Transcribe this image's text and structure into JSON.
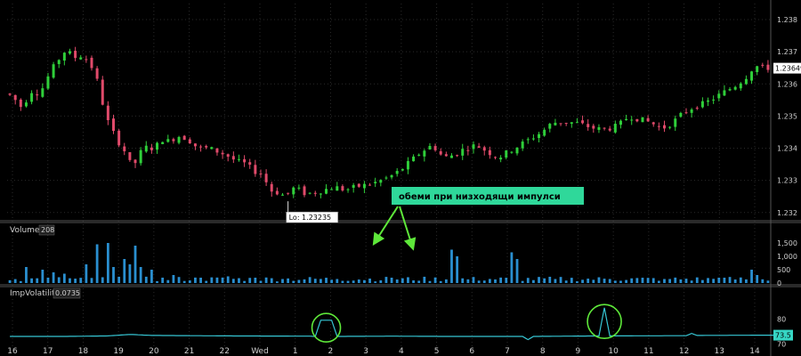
{
  "colors": {
    "background": "#000000",
    "grid": "#2a2a2a",
    "panel_border": "#555555",
    "candle_up": "#2fcf3a",
    "candle_down": "#e04a6a",
    "volume": "#2a8fd0",
    "volatility": "#36c6d4",
    "annotation_bg": "#2fd89a",
    "annotation_arrow": "#5ee83a",
    "price_tag_bg": "#ffffff",
    "vol_tag_bg": "#36d6c4",
    "axis_text": "#cfcfcf"
  },
  "chart_data": [
    {
      "type": "candlestick",
      "panel": "price",
      "x_ticks": [
        "16",
        "17",
        "18",
        "19",
        "20",
        "21",
        "22",
        "Wed",
        "1",
        "2",
        "3",
        "4",
        "5",
        "6",
        "7",
        "8",
        "9",
        "10",
        "11",
        "12",
        "13",
        "14"
      ],
      "y_ticks": [
        "1.238",
        "1.237",
        "1.236",
        "1.235",
        "1.234",
        "1.233",
        "1.232"
      ],
      "ylim": [
        1.2318,
        1.2385
      ],
      "current_price": "1.23649",
      "low_label": "Lo: 1.23235",
      "low_value": 1.23235,
      "annotation": "обеми при низходящи импулси",
      "path": [
        [
          0,
          1.2357
        ],
        [
          1,
          1.2356
        ],
        [
          2,
          1.2354
        ],
        [
          3,
          1.2352
        ],
        [
          4,
          1.2358
        ],
        [
          6,
          1.2357
        ],
        [
          8,
          1.2364
        ],
        [
          10,
          1.2369
        ],
        [
          11,
          1.2371
        ],
        [
          12,
          1.2368
        ],
        [
          14,
          1.2369
        ],
        [
          16,
          1.2364
        ],
        [
          17,
          1.2358
        ],
        [
          18,
          1.235
        ],
        [
          20,
          1.2343
        ],
        [
          22,
          1.2338
        ],
        [
          23,
          1.2333
        ],
        [
          24,
          1.2338
        ],
        [
          26,
          1.2341
        ],
        [
          27,
          1.2339
        ],
        [
          28,
          1.2343
        ],
        [
          30,
          1.2342
        ],
        [
          31,
          1.2344
        ],
        [
          33,
          1.2343
        ],
        [
          35,
          1.234
        ],
        [
          37,
          1.234
        ],
        [
          40,
          1.2338
        ],
        [
          42,
          1.2336
        ],
        [
          44,
          1.2335
        ],
        [
          45,
          1.2333
        ],
        [
          47,
          1.2332
        ],
        [
          48,
          1.2327
        ],
        [
          50,
          1.2326
        ],
        [
          51,
          1.2325
        ],
        [
          52,
          1.2327
        ],
        [
          53,
          1.2328
        ],
        [
          54,
          1.2326
        ],
        [
          56,
          1.2326
        ],
        [
          58,
          1.2327
        ],
        [
          60,
          1.2328
        ],
        [
          62,
          1.2327
        ],
        [
          64,
          1.2328
        ],
        [
          67,
          1.2329
        ],
        [
          70,
          1.2331
        ],
        [
          72,
          1.2333
        ],
        [
          74,
          1.2336
        ],
        [
          76,
          1.2339
        ],
        [
          78,
          1.2341
        ],
        [
          80,
          1.2337
        ],
        [
          82,
          1.2338
        ],
        [
          84,
          1.234
        ],
        [
          86,
          1.2341
        ],
        [
          88,
          1.2339
        ],
        [
          90,
          1.2337
        ],
        [
          92,
          1.2339
        ],
        [
          94,
          1.2341
        ],
        [
          96,
          1.2343
        ],
        [
          98,
          1.2345
        ],
        [
          100,
          1.2348
        ],
        [
          102,
          1.2348
        ],
        [
          104,
          1.2348
        ],
        [
          106,
          1.2347
        ],
        [
          108,
          1.2346
        ],
        [
          110,
          1.2346
        ],
        [
          112,
          1.2347
        ],
        [
          114,
          1.235
        ],
        [
          116,
          1.2349
        ],
        [
          118,
          1.2348
        ],
        [
          120,
          1.2346
        ],
        [
          122,
          1.2348
        ],
        [
          124,
          1.2351
        ],
        [
          126,
          1.2353
        ],
        [
          128,
          1.2354
        ],
        [
          130,
          1.2356
        ],
        [
          132,
          1.2358
        ],
        [
          134,
          1.236
        ],
        [
          136,
          1.2363
        ],
        [
          137,
          1.2366
        ],
        [
          138,
          1.2365
        ]
      ]
    },
    {
      "type": "bar",
      "panel": "volume",
      "title": "Volume",
      "value_label": "208",
      "y_ticks": [
        "1,500",
        "1,000",
        "500",
        "0"
      ],
      "ylim": [
        0,
        1800
      ],
      "baseline": 150,
      "spikes": [
        [
          3,
          600
        ],
        [
          6,
          500
        ],
        [
          8,
          400
        ],
        [
          10,
          350
        ],
        [
          14,
          700
        ],
        [
          16,
          1450
        ],
        [
          18,
          1500
        ],
        [
          19,
          600
        ],
        [
          21,
          900
        ],
        [
          22,
          700
        ],
        [
          23,
          1400
        ],
        [
          24,
          600
        ],
        [
          26,
          500
        ],
        [
          30,
          300
        ],
        [
          35,
          200
        ],
        [
          40,
          250
        ],
        [
          45,
          200
        ],
        [
          50,
          150
        ],
        [
          60,
          150
        ],
        [
          70,
          200
        ],
        [
          81,
          1250
        ],
        [
          82,
          1000
        ],
        [
          92,
          1150
        ],
        [
          93,
          900
        ],
        [
          100,
          150
        ],
        [
          110,
          150
        ],
        [
          120,
          150
        ],
        [
          130,
          200
        ],
        [
          136,
          500
        ],
        [
          137,
          300
        ]
      ]
    },
    {
      "type": "line",
      "panel": "volatility",
      "title": "ImpVolatility",
      "value_label": "0.0735",
      "y_ticks": [
        "80",
        "70"
      ],
      "current_value": "73.5",
      "ylim": [
        68,
        88
      ],
      "path": [
        [
          0,
          73.0
        ],
        [
          10,
          73.0
        ],
        [
          18,
          73.2
        ],
        [
          22,
          73.8
        ],
        [
          26,
          73.4
        ],
        [
          40,
          73.2
        ],
        [
          55,
          73.1
        ],
        [
          56,
          73.0
        ],
        [
          57,
          79.5
        ],
        [
          59,
          79.5
        ],
        [
          60,
          73.0
        ],
        [
          70,
          73.1
        ],
        [
          80,
          73.0
        ],
        [
          94,
          73.0
        ],
        [
          95,
          71.7
        ],
        [
          96,
          73.0
        ],
        [
          108,
          73.2
        ],
        [
          109,
          84.5
        ],
        [
          110,
          73.2
        ],
        [
          124,
          73.3
        ],
        [
          125,
          74.2
        ],
        [
          126,
          73.4
        ],
        [
          138,
          73.5
        ]
      ]
    }
  ]
}
